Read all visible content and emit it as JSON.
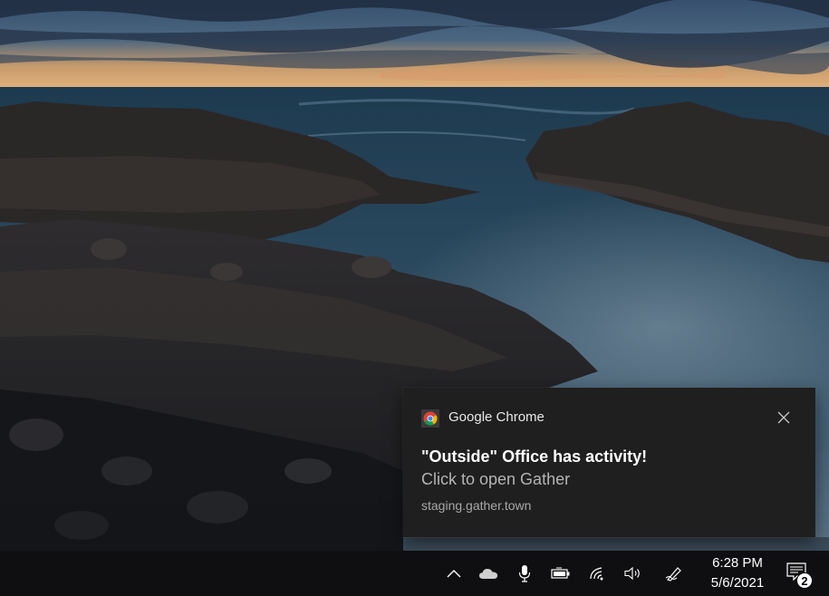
{
  "notification": {
    "app_name": "Google Chrome",
    "title": "\"Outside\" Office has activity!",
    "body": "Click to open Gather",
    "source": "staging.gather.town",
    "app_icon": "chrome-icon",
    "close_icon": "close-icon"
  },
  "taskbar": {
    "tray_icons": [
      "chevron-up-icon",
      "onedrive-cloud-icon",
      "microphone-icon",
      "battery-icon",
      "wifi-icon",
      "volume-icon",
      "pen-workspace-icon"
    ],
    "clock": {
      "time": "6:28 PM",
      "date": "5/6/2021"
    },
    "action_center": {
      "icon": "notifications-icon",
      "count": "2"
    }
  },
  "colors": {
    "toast_background": "#1f1f1f",
    "taskbar_background": "#0f0f11",
    "secondary_text": "#b4b4b4"
  }
}
